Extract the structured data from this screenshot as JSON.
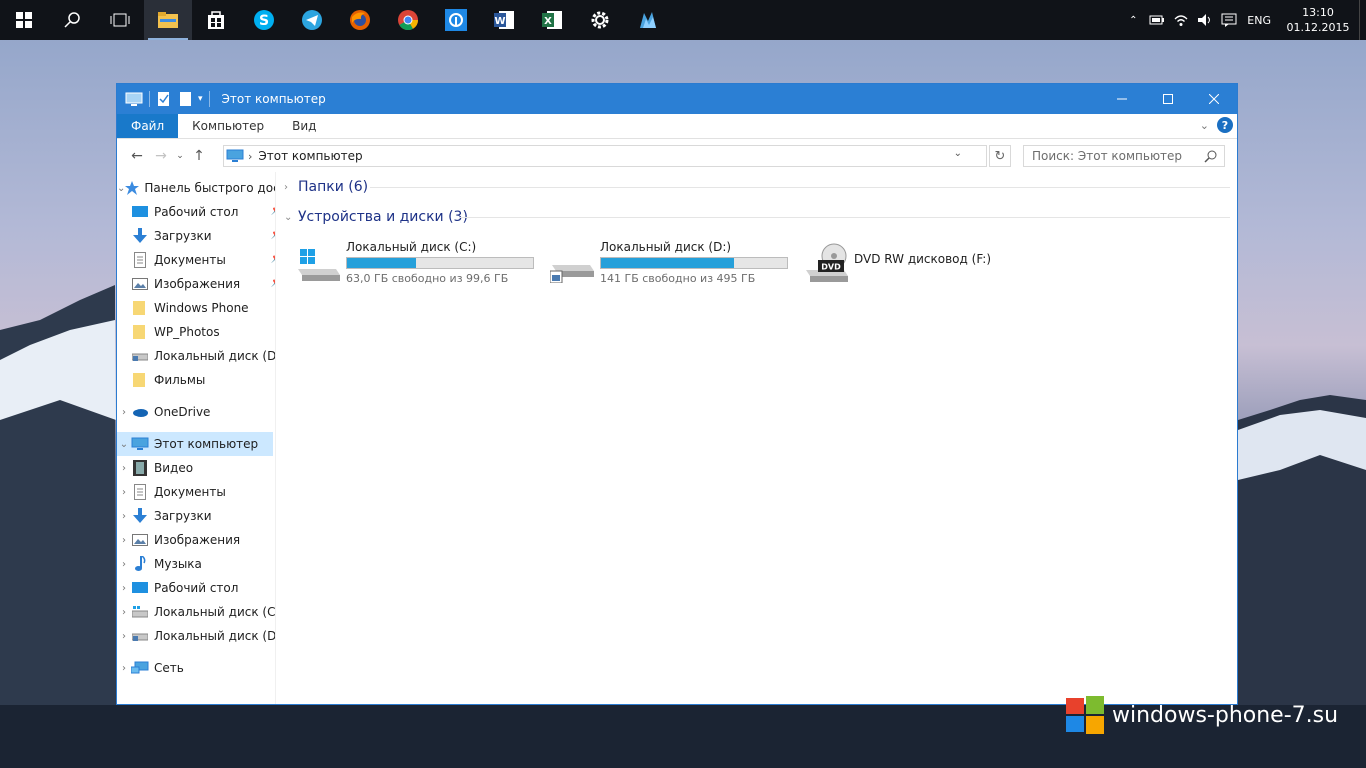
{
  "taskbar": {
    "apps": [
      {
        "name": "file-explorer-icon",
        "color": "#f2c14e"
      },
      {
        "name": "store-icon",
        "color": "#ffffff"
      },
      {
        "name": "skype-icon",
        "color": "#00aff0"
      },
      {
        "name": "telegram-icon",
        "color": "#2ca5e0"
      },
      {
        "name": "firefox-icon",
        "color": "#e66000"
      },
      {
        "name": "chrome-icon",
        "color": "#4285f4"
      },
      {
        "name": "app-icon",
        "color": "#1e88e5"
      },
      {
        "name": "word-icon",
        "color": "#2b579a"
      },
      {
        "name": "excel-icon",
        "color": "#217346"
      },
      {
        "name": "settings-icon",
        "color": "#ffffff"
      },
      {
        "name": "app2-icon",
        "color": "#4aa3df"
      }
    ],
    "lang": "ENG",
    "time": "13:10",
    "date": "01.12.2015"
  },
  "window": {
    "title": "Этот компьютер",
    "ribbon_tabs": [
      "Файл",
      "Компьютер",
      "Вид"
    ],
    "address": "Этот компьютер",
    "search_placeholder": "Поиск: Этот компьютер"
  },
  "sidebar": {
    "quick_access": "Панель быстрого доступа",
    "quick_items": [
      "Рабочий стол",
      "Загрузки",
      "Документы",
      "Изображения",
      "Windows Phone",
      "WP_Photos",
      "Локальный диск (D:)",
      "Фильмы"
    ],
    "onedrive": "OneDrive",
    "this_pc": "Этот компьютер",
    "pc_items": [
      "Видео",
      "Документы",
      "Загрузки",
      "Изображения",
      "Музыка",
      "Рабочий стол",
      "Локальный диск (C:)",
      "Локальный диск (D:)"
    ],
    "network": "Сеть"
  },
  "content": {
    "folders_group": "Папки (6)",
    "devices_group": "Устройства и диски (3)",
    "drives": [
      {
        "name": "Локальный диск (C:)",
        "free": "63,0 ГБ свободно из 99,6 ГБ",
        "used_fraction": 0.37
      },
      {
        "name": "Локальный диск (D:)",
        "free": "141 ГБ свободно из 495 ГБ",
        "used_fraction": 0.715
      },
      {
        "name": "DVD RW дисковод (F:)"
      }
    ]
  },
  "watermark": "windows-phone-7.su",
  "colors": {
    "accent": "#2b7fd4",
    "selection": "#cce8ff",
    "bar_fill": "#26a0da"
  }
}
